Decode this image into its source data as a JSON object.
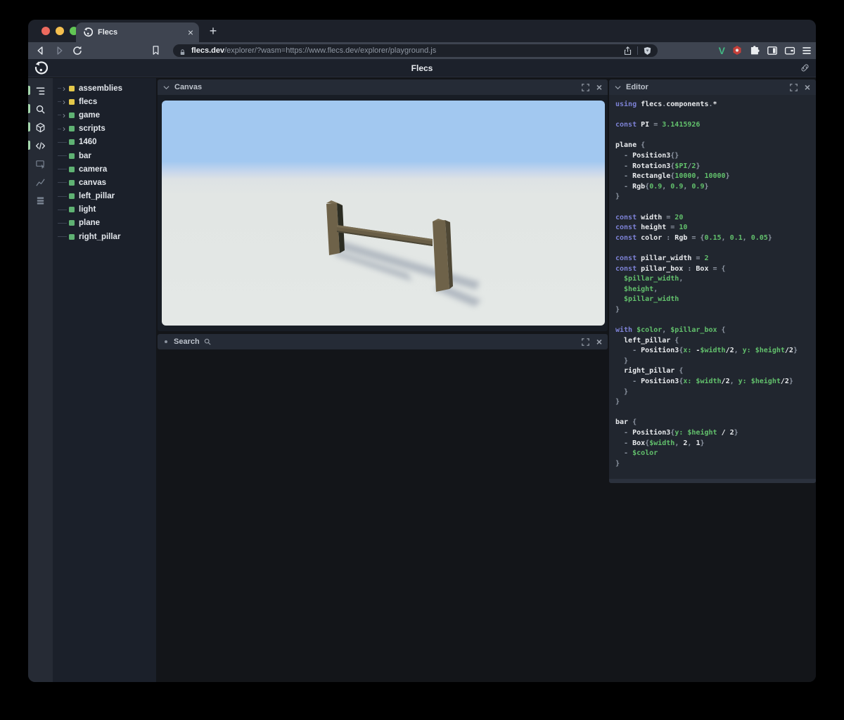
{
  "glyphs": {
    "close": "×",
    "plus": "+",
    "chevron": "›"
  },
  "browser": {
    "tab_title": "Flecs",
    "url_domain": "flecs.dev",
    "url_path": "/explorer/?wasm=https://www.flecs.dev/explorer/playground.js",
    "vue_glyph": "V"
  },
  "header": {
    "title": "Flecs"
  },
  "sidebar": {
    "icons": [
      {
        "name": "tree-view",
        "active": true
      },
      {
        "name": "search",
        "active": true
      },
      {
        "name": "entities",
        "active": true
      },
      {
        "name": "code",
        "active": true
      },
      {
        "name": "inspector",
        "active": false
      },
      {
        "name": "stats",
        "active": false
      },
      {
        "name": "queries",
        "active": false
      }
    ]
  },
  "tree": {
    "items": [
      {
        "label": "assemblies",
        "dot": "yellow",
        "expandable": true
      },
      {
        "label": "flecs",
        "dot": "yellow",
        "expandable": true
      },
      {
        "label": "game",
        "dot": "green",
        "expandable": true
      },
      {
        "label": "scripts",
        "dot": "green",
        "expandable": true
      },
      {
        "label": "1460",
        "dot": "green",
        "expandable": false
      },
      {
        "label": "bar",
        "dot": "green",
        "expandable": false
      },
      {
        "label": "camera",
        "dot": "green",
        "expandable": false
      },
      {
        "label": "canvas",
        "dot": "green",
        "expandable": false
      },
      {
        "label": "left_pillar",
        "dot": "green",
        "expandable": false
      },
      {
        "label": "light",
        "dot": "green",
        "expandable": false
      },
      {
        "label": "plane",
        "dot": "green",
        "expandable": false
      },
      {
        "label": "right_pillar",
        "dot": "green",
        "expandable": false
      }
    ]
  },
  "panels": {
    "canvas": {
      "title": "Canvas"
    },
    "search": {
      "title": "Search"
    },
    "editor": {
      "title": "Editor"
    }
  },
  "editor": {
    "lines": [
      [
        [
          "k",
          "using "
        ],
        [
          "w",
          "flecs"
        ],
        [
          "p",
          "."
        ],
        [
          "w",
          "components"
        ],
        [
          "p",
          "."
        ],
        [
          "w",
          "*"
        ]
      ],
      [],
      [
        [
          "k",
          "const "
        ],
        [
          "w",
          "PI "
        ],
        [
          "p",
          "= "
        ],
        [
          "g",
          "3.1415926"
        ]
      ],
      [],
      [
        [
          "w",
          "plane "
        ],
        [
          "p",
          "{"
        ]
      ],
      [
        [
          "p",
          "  - "
        ],
        [
          "w",
          "Position3"
        ],
        [
          "p",
          "{}"
        ]
      ],
      [
        [
          "p",
          "  - "
        ],
        [
          "w",
          "Rotation3"
        ],
        [
          "p",
          "{"
        ],
        [
          "g",
          "$PI"
        ],
        [
          "p",
          "/"
        ],
        [
          "g",
          "2"
        ],
        [
          "p",
          "}"
        ]
      ],
      [
        [
          "p",
          "  - "
        ],
        [
          "w",
          "Rectangle"
        ],
        [
          "p",
          "{"
        ],
        [
          "g",
          "10000"
        ],
        [
          "p",
          ", "
        ],
        [
          "g",
          "10000"
        ],
        [
          "p",
          "}"
        ]
      ],
      [
        [
          "p",
          "  - "
        ],
        [
          "w",
          "Rgb"
        ],
        [
          "p",
          "{"
        ],
        [
          "g",
          "0.9"
        ],
        [
          "p",
          ", "
        ],
        [
          "g",
          "0.9"
        ],
        [
          "p",
          ", "
        ],
        [
          "g",
          "0.9"
        ],
        [
          "p",
          "}"
        ]
      ],
      [
        [
          "p",
          "}"
        ]
      ],
      [],
      [
        [
          "k",
          "const "
        ],
        [
          "w",
          "width "
        ],
        [
          "p",
          "= "
        ],
        [
          "g",
          "20"
        ]
      ],
      [
        [
          "k",
          "const "
        ],
        [
          "w",
          "height "
        ],
        [
          "p",
          "= "
        ],
        [
          "g",
          "10"
        ]
      ],
      [
        [
          "k",
          "const "
        ],
        [
          "w",
          "color "
        ],
        [
          "p",
          ": "
        ],
        [
          "w",
          "Rgb "
        ],
        [
          "p",
          "= {"
        ],
        [
          "g",
          "0.15"
        ],
        [
          "p",
          ", "
        ],
        [
          "g",
          "0.1"
        ],
        [
          "p",
          ", "
        ],
        [
          "g",
          "0.05"
        ],
        [
          "p",
          "}"
        ]
      ],
      [],
      [
        [
          "k",
          "const "
        ],
        [
          "w",
          "pillar_width "
        ],
        [
          "p",
          "= "
        ],
        [
          "g",
          "2"
        ]
      ],
      [
        [
          "k",
          "const "
        ],
        [
          "w",
          "pillar_box "
        ],
        [
          "p",
          ": "
        ],
        [
          "w",
          "Box "
        ],
        [
          "p",
          "= {"
        ]
      ],
      [
        [
          "g",
          "  $pillar_width"
        ],
        [
          "p",
          ","
        ]
      ],
      [
        [
          "g",
          "  $height"
        ],
        [
          "p",
          ","
        ]
      ],
      [
        [
          "g",
          "  $pillar_width"
        ]
      ],
      [
        [
          "p",
          "}"
        ]
      ],
      [],
      [
        [
          "k",
          "with "
        ],
        [
          "g",
          "$color"
        ],
        [
          "p",
          ", "
        ],
        [
          "g",
          "$pillar_box"
        ],
        [
          "p",
          " {"
        ]
      ],
      [
        [
          "w",
          "  left_pillar "
        ],
        [
          "p",
          "{"
        ]
      ],
      [
        [
          "p",
          "    - "
        ],
        [
          "w",
          "Position3"
        ],
        [
          "p",
          "{"
        ],
        [
          "g",
          "x:"
        ],
        [
          "w",
          " -"
        ],
        [
          "g",
          "$width"
        ],
        [
          "w",
          "/2"
        ],
        [
          "p",
          ", "
        ],
        [
          "g",
          "y:"
        ],
        [
          "w",
          " "
        ],
        [
          "g",
          "$height"
        ],
        [
          "w",
          "/2"
        ],
        [
          "p",
          "}"
        ]
      ],
      [
        [
          "p",
          "  }"
        ]
      ],
      [
        [
          "w",
          "  right_pillar "
        ],
        [
          "p",
          "{"
        ]
      ],
      [
        [
          "p",
          "    - "
        ],
        [
          "w",
          "Position3"
        ],
        [
          "p",
          "{"
        ],
        [
          "g",
          "x:"
        ],
        [
          "w",
          " "
        ],
        [
          "g",
          "$width"
        ],
        [
          "w",
          "/2"
        ],
        [
          "p",
          ", "
        ],
        [
          "g",
          "y:"
        ],
        [
          "w",
          " "
        ],
        [
          "g",
          "$height"
        ],
        [
          "w",
          "/2"
        ],
        [
          "p",
          "}"
        ]
      ],
      [
        [
          "p",
          "  }"
        ]
      ],
      [
        [
          "p",
          "}"
        ]
      ],
      [],
      [
        [
          "w",
          "bar "
        ],
        [
          "p",
          "{"
        ]
      ],
      [
        [
          "p",
          "  - "
        ],
        [
          "w",
          "Position3"
        ],
        [
          "p",
          "{"
        ],
        [
          "g",
          "y:"
        ],
        [
          "w",
          " "
        ],
        [
          "g",
          "$height"
        ],
        [
          "w",
          " / 2"
        ],
        [
          "p",
          "}"
        ]
      ],
      [
        [
          "p",
          "  - "
        ],
        [
          "w",
          "Box"
        ],
        [
          "p",
          "{"
        ],
        [
          "g",
          "$width"
        ],
        [
          "p",
          ", "
        ],
        [
          "w",
          "2"
        ],
        [
          "p",
          ", "
        ],
        [
          "w",
          "1"
        ],
        [
          "p",
          "}"
        ]
      ],
      [
        [
          "p",
          "  - "
        ],
        [
          "g",
          "$color"
        ]
      ],
      [
        [
          "p",
          "}"
        ]
      ]
    ]
  },
  "colors": {
    "accent_green": "#a6d8ae",
    "square_green": "#5fb273",
    "square_yellow": "#e4c84a",
    "code_kw": "#7d82d6",
    "code_green": "#62c06c",
    "code_plain": "#e9ebee",
    "code_punc": "#8d95a2",
    "vue_green": "#42b883",
    "ext_red": "#c5403a",
    "sky": "#a2c8f0",
    "ground": "#e2e6e4",
    "wood": "#6e6249",
    "wood_dark": "#2c2d23",
    "wood_side": "#4e4735",
    "wood_top": "#7b6f55",
    "shadow": "#8792a3"
  }
}
